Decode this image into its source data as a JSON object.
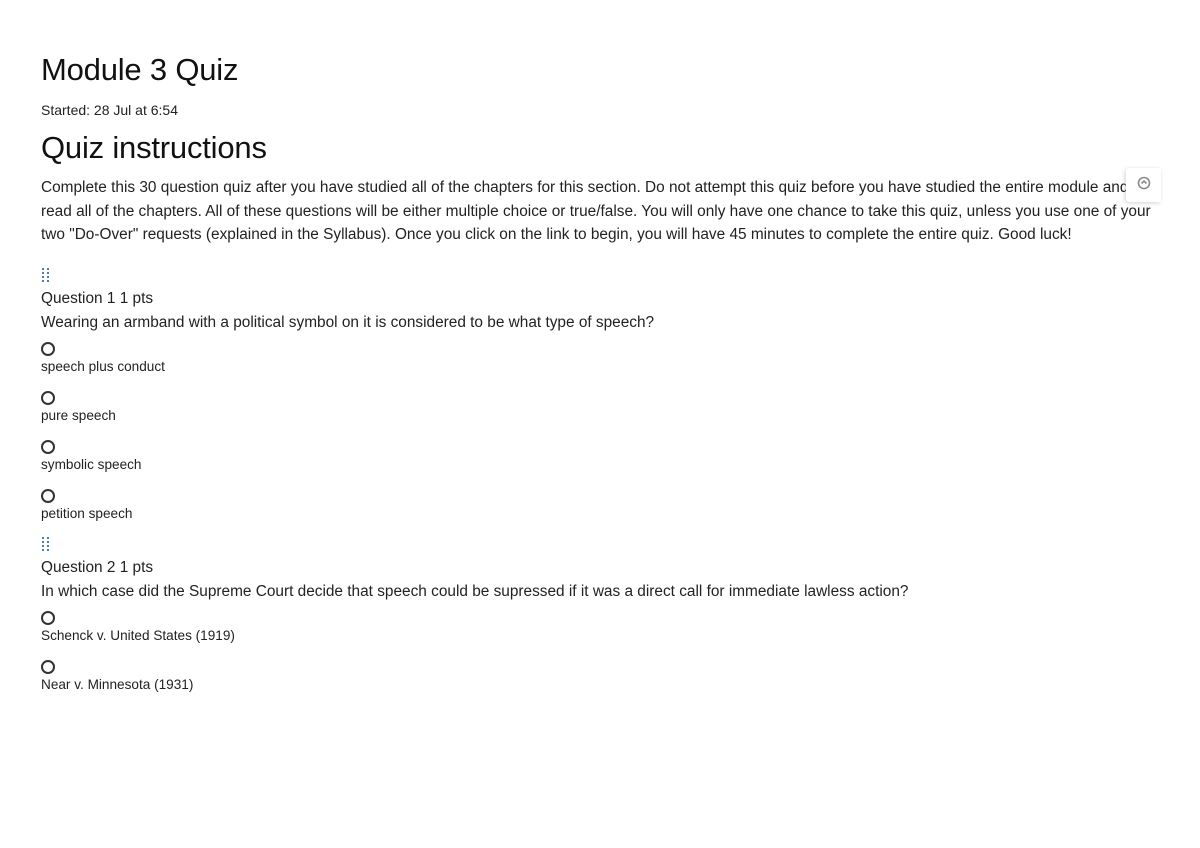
{
  "quiz": {
    "title": "Module 3 Quiz",
    "started": "Started: 28 Jul at 6:54",
    "instructions_heading": "Quiz instructions",
    "instructions": "Complete this 30 question quiz after you have studied all of the chapters for this section. Do not attempt this quiz before you have studied the entire module and read all of the chapters. All of these questions will be either multiple choice or true/false. You will only have one chance to take this quiz, unless you use one of your two \"Do-Over\" requests (explained in the Syllabus). Once you click on the link to begin, you will have 45 minutes to complete the entire quiz. Good luck!"
  },
  "questions": [
    {
      "header": "Question 1 1 pts",
      "text": "Wearing an armband with a political symbol on it is considered to be what type of speech?",
      "answers": [
        "speech plus conduct",
        "pure speech",
        "symbolic speech",
        "petition speech"
      ]
    },
    {
      "header": "Question 2 1 pts",
      "text": "In which case did the Supreme Court decide that speech could be supressed if it was a direct call for immediate lawless action?",
      "answers": [
        "Schenck v. United States (1919)",
        "Near v. Minnesota (1931)"
      ]
    }
  ],
  "icons": {
    "drag_handle": "drag-handle-icon",
    "side_tab": "side-tab-icon"
  },
  "colors": {
    "drag_handle": "#4a7fb5",
    "text": "#222222"
  }
}
